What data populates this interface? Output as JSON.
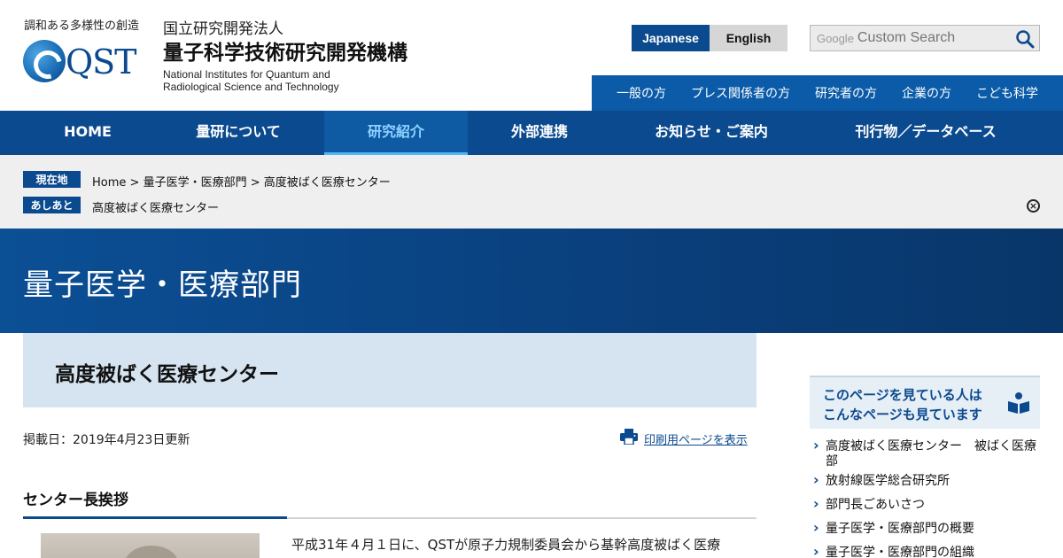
{
  "header": {
    "tagline": "調和ある多様性の創造",
    "logo_text": "QST",
    "org_kind": "国立研究開発法人",
    "org_name": "量子科学技術研究開発機構",
    "org_en_line1": "National Institutes for Quantum and",
    "org_en_line2": "Radiological Science and Technology"
  },
  "language": {
    "japanese": "Japanese",
    "english": "English",
    "active": "Japanese"
  },
  "search": {
    "google_label": "Google",
    "placeholder": "Custom Search"
  },
  "audience_nav": [
    "一般の方",
    "プレス関係者の方",
    "研究者の方",
    "企業の方",
    "こども科学"
  ],
  "main_nav": {
    "items": [
      "HOME",
      "量研について",
      "研究紹介",
      "外部連携",
      "お知らせ・ご案内",
      "刊行物／データベース"
    ],
    "active": "研究紹介"
  },
  "breadcrumb": {
    "current_tag": "現在地",
    "path": [
      "Home",
      "量子医学・医療部門",
      "高度被ばく医療センター"
    ],
    "separator": ">",
    "history_tag": "あしあと",
    "history": "高度被ばく医療センター"
  },
  "banner": {
    "title": "量子医学・医療部門"
  },
  "page": {
    "title": "高度被ばく医療センター",
    "posted": "掲載日：2019年4月23日更新",
    "print_label": "印刷用ページを表示",
    "section_heading": "センター長挨拶",
    "body_first_line": "平成31年４月１日に、QSTが原子力規制委員会から基幹高度被ばく医療"
  },
  "sidebar": {
    "heading_line1": "このページを見ている人は",
    "heading_line2": "こんなページも見ています",
    "links": [
      "高度被ばく医療センター　被ばく医療部",
      "放射線医学総合研究所",
      "部門長ごあいさつ",
      "量子医学・医療部門の概要",
      "量子医学・医療部門の組織"
    ]
  },
  "colors": {
    "brand_blue": "#0b4a8e",
    "nav_active_text": "#8ed1ff",
    "title_box_bg": "#d6e4f1",
    "crumb_bg": "#efefef"
  }
}
